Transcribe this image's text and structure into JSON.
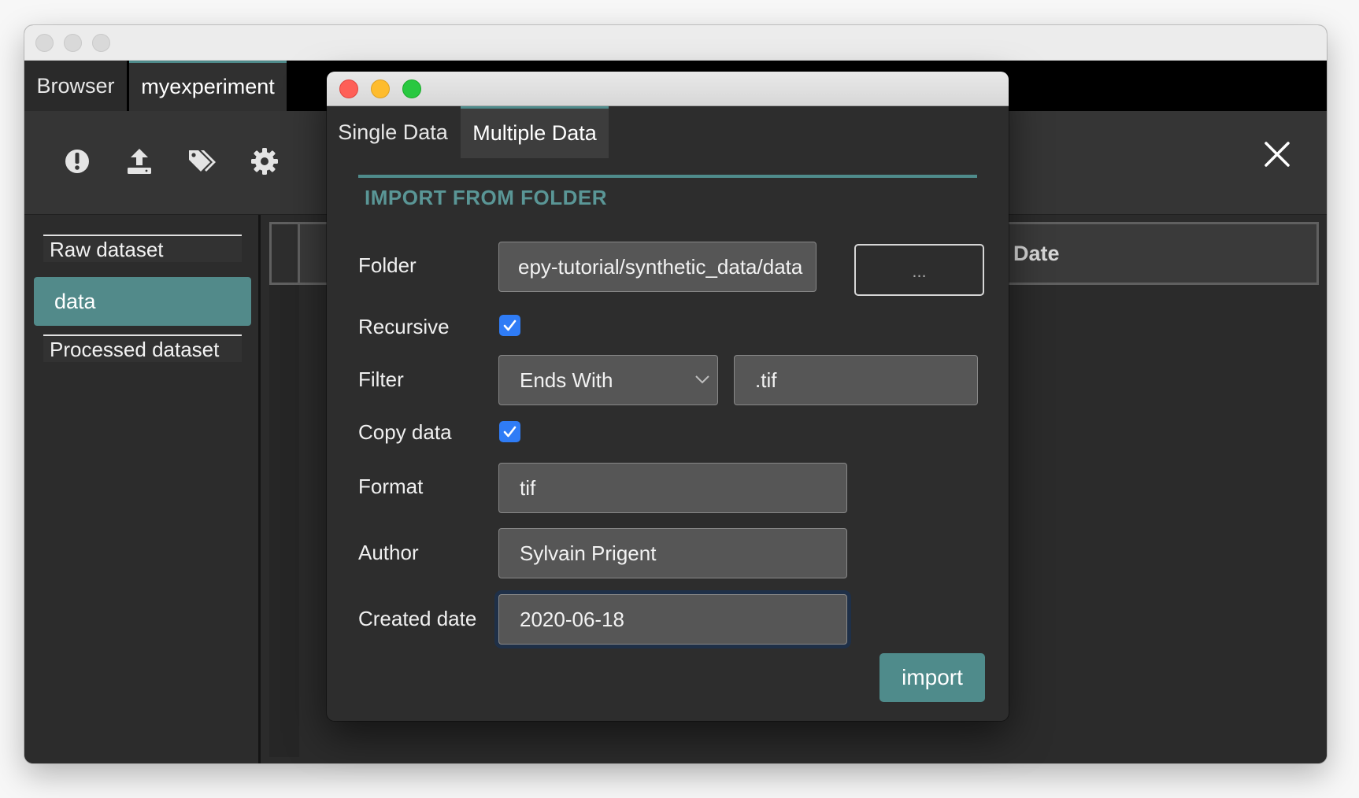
{
  "main_window": {
    "tabs": [
      {
        "label": "Browser"
      },
      {
        "label": "myexperiment"
      }
    ],
    "toolbar": {
      "icons": [
        "exclamation-circle-icon",
        "upload-icon",
        "tags-icon",
        "gear-icon"
      ],
      "close_icon": "close-icon"
    },
    "sidebar": {
      "raw_dataset_label": "Raw dataset",
      "data_item_label": "data",
      "processed_dataset_label": "Processed dataset"
    },
    "table": {
      "date_header": "Date"
    }
  },
  "dialog": {
    "tabs": [
      {
        "label": "Single Data"
      },
      {
        "label": "Multiple Data"
      }
    ],
    "section_title": "IMPORT FROM FOLDER",
    "folder": {
      "label": "Folder",
      "value": "epy-tutorial/synthetic_data/data",
      "browse_label": "..."
    },
    "recursive": {
      "label": "Recursive",
      "checked": true
    },
    "filter": {
      "label": "Filter",
      "mode": "Ends With",
      "value": ".tif"
    },
    "copy_data": {
      "label": "Copy data",
      "checked": true
    },
    "format": {
      "label": "Format",
      "value": "tif"
    },
    "author": {
      "label": "Author",
      "value": "Sylvain Prigent"
    },
    "created_date": {
      "label": "Created date",
      "value": "2020-06-18"
    },
    "import_button": "import"
  },
  "colors": {
    "accent_teal": "#4f8b8b",
    "checkbox_blue": "#2f7cf6",
    "traffic_close": "#fe5f57",
    "traffic_minimize": "#febc2e",
    "traffic_maximize": "#28c840"
  }
}
